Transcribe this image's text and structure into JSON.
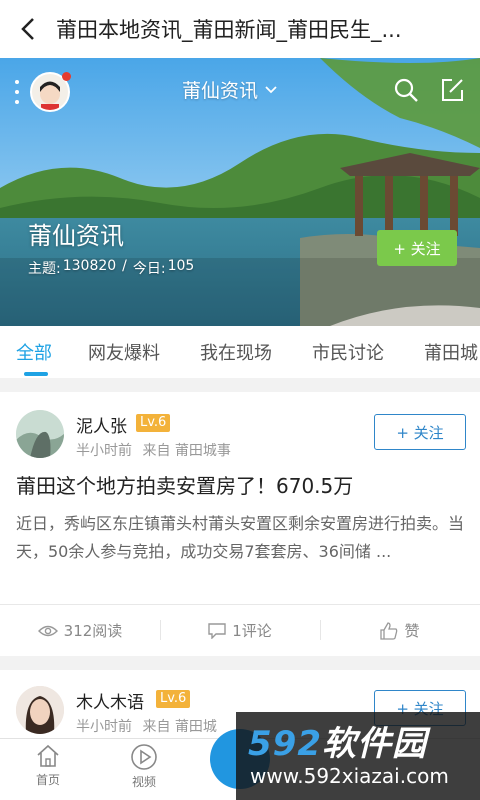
{
  "topbar": {
    "title": "莆田本地资讯_莆田新闻_莆田民生_..."
  },
  "hero": {
    "channel": "莆仙资讯",
    "name": "莆仙资讯",
    "stats": {
      "topics_label": "主题:",
      "topics": "130820",
      "separator": "/",
      "today_label": "今日:",
      "today": "105"
    },
    "follow_label": "+ 关注"
  },
  "tabs": [
    "全部",
    "网友爆料",
    "我在现场",
    "市民讨论",
    "莆田城"
  ],
  "posts": [
    {
      "user": "泥人张",
      "level": "Lv.6",
      "time": "半小时前",
      "source": "来自  莆田城事",
      "follow_label": "+ 关注",
      "title": "莆田这个地方拍卖安置房了！670.5万",
      "body": "近日，秀屿区东庄镇莆头村莆头安置区剩余安置房进行拍卖。当天，50余人参与竞拍，成功交易7套套房、36间储 ...",
      "views": "312阅读",
      "comments": "1评论",
      "likes": "赞"
    },
    {
      "user": "木人木语",
      "level": "Lv.6",
      "time": "半小时前",
      "source": "来自  莆田城",
      "follow_label": "+ 关注"
    }
  ],
  "bottom_nav": {
    "home": "首页",
    "video": "视频"
  },
  "watermark": {
    "logo_num": "592",
    "logo_text": "软件园",
    "url": "www.592xiazai.com"
  },
  "colors": {
    "accent": "#1ea2e4",
    "follow_green": "#7bc94b",
    "level_badge": "#f3b23a",
    "outline_blue": "#2f86c9"
  }
}
